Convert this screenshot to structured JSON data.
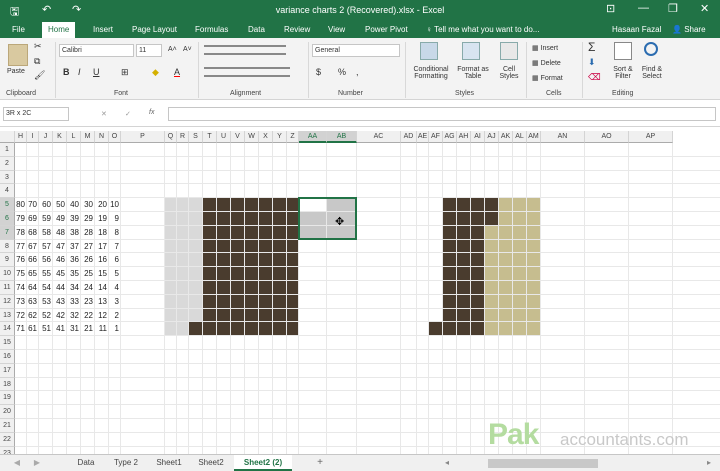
{
  "titlebar": {
    "title": "variance charts 2 (Recovered).xlsx - Excel",
    "save": "🖫",
    "undo": "↶",
    "redo": "↷",
    "user_btn": "⊡",
    "min": "—",
    "restore": "❐",
    "close": "✕"
  },
  "tabs": [
    "File",
    "Home",
    "Insert",
    "Page Layout",
    "Formulas",
    "Data",
    "Review",
    "View",
    "Power Pivot"
  ],
  "tell_me": "Tell me what you want to do...",
  "user": "Hasaan Fazal",
  "share": "Share",
  "ribbon": {
    "paste": "Paste",
    "cut": "✂",
    "copy": "⧉",
    "brush": "🖌",
    "font_name": "Calibri",
    "font_size": "11",
    "grow": "A˄",
    "shrink": "A˅",
    "bold": "B",
    "italic": "I",
    "underline": "U",
    "border": "⊞",
    "fill": "◆",
    "fontcolor": "A",
    "number_format": "General",
    "currency": "$",
    "percent": "%",
    "comma": ",",
    "cond_fmt": "Conditional Formatting",
    "format_table": "Format as Table",
    "cell_styles": "Cell Styles",
    "insert": "Insert",
    "delete": "Delete",
    "format": "Format",
    "sum": "Σ",
    "fill_down": "⬇",
    "clear": "⌫",
    "sort": "Sort & Filter",
    "find": "Find & Select",
    "groups": {
      "clipboard": "Clipboard",
      "font": "Font",
      "alignment": "Alignment",
      "number": "Number",
      "styles": "Styles",
      "cells": "Cells",
      "editing": "Editing"
    }
  },
  "formula": {
    "name_box": "3R x 2C",
    "cancel": "✕",
    "enter": "✓",
    "fx": "fx",
    "value": ""
  },
  "columns": [
    "H",
    "I",
    "J",
    "K",
    "L",
    "M",
    "N",
    "O",
    "P",
    "Q",
    "R",
    "S",
    "T",
    "U",
    "V",
    "W",
    "X",
    "Y",
    "Z",
    "AA",
    "AB",
    "AC",
    "AD",
    "AE",
    "AF",
    "AG",
    "AH",
    "AI",
    "AJ",
    "AK",
    "AL",
    "AM",
    "AN",
    "AO",
    "AP"
  ],
  "rows": [
    "1",
    "2",
    "3",
    "4",
    "5",
    "6",
    "7",
    "8",
    "9",
    "10",
    "11",
    "12",
    "13",
    "14",
    "15",
    "16",
    "17",
    "18",
    "19",
    "20",
    "21",
    "22",
    "23"
  ],
  "table": [
    [
      "80",
      "70",
      "60",
      "50",
      "40",
      "30",
      "20",
      "10"
    ],
    [
      "79",
      "69",
      "59",
      "49",
      "39",
      "29",
      "19",
      "9"
    ],
    [
      "78",
      "68",
      "58",
      "48",
      "38",
      "28",
      "18",
      "8"
    ],
    [
      "77",
      "67",
      "57",
      "47",
      "37",
      "27",
      "17",
      "7"
    ],
    [
      "76",
      "66",
      "56",
      "46",
      "36",
      "26",
      "16",
      "6"
    ],
    [
      "75",
      "65",
      "55",
      "45",
      "35",
      "25",
      "15",
      "5"
    ],
    [
      "74",
      "64",
      "54",
      "44",
      "34",
      "24",
      "14",
      "4"
    ],
    [
      "73",
      "63",
      "53",
      "43",
      "33",
      "23",
      "13",
      "3"
    ],
    [
      "72",
      "62",
      "52",
      "42",
      "32",
      "22",
      "12",
      "2"
    ],
    [
      "71",
      "61",
      "51",
      "41",
      "31",
      "21",
      "11",
      "1"
    ]
  ],
  "sheets": [
    "Data",
    "Type 2",
    "Sheet1",
    "Sheet2",
    "Sheet2 (2)"
  ],
  "active_sheet": "Sheet2 (2)",
  "new_sheet": "+",
  "watermark": {
    "brand": "Pak",
    "domain": "accountants.com"
  },
  "colors": {
    "excel_green": "#217346",
    "dark": "#4a3c2e",
    "light_gray": "#d9d9d9",
    "tan": "#c6bd8f",
    "sel_gray": "#c8c8c8"
  }
}
